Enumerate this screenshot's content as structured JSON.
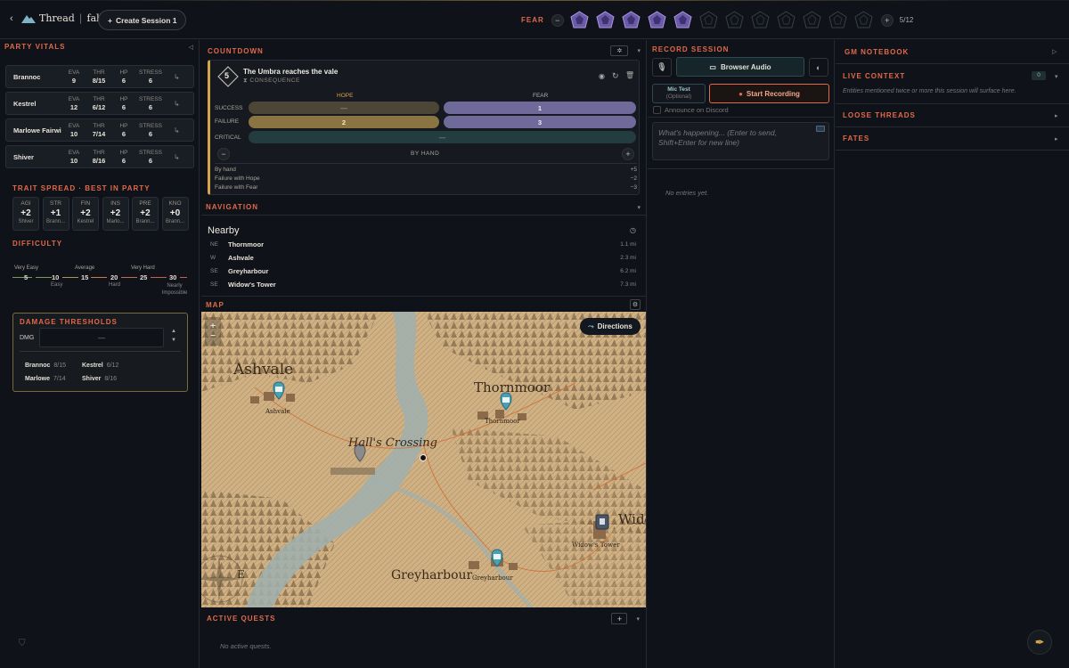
{
  "app": {
    "brand_left": "Thread",
    "brand_right": "fall",
    "create_session": "Create Session 1"
  },
  "fear": {
    "label": "FEAR",
    "filled": 5,
    "total": 12,
    "counter": "5/12"
  },
  "party": {
    "title": "PARTY VITALS",
    "members": [
      {
        "name": "Brannoc",
        "eva": "9",
        "thr": "8/15",
        "hp": "6",
        "stress": "6"
      },
      {
        "name": "Kestrel",
        "eva": "12",
        "thr": "6/12",
        "hp": "6",
        "stress": "6"
      },
      {
        "name": "Marlowe Fairwi...",
        "eva": "10",
        "thr": "7/14",
        "hp": "6",
        "stress": "6"
      },
      {
        "name": "Shiver",
        "eva": "10",
        "thr": "8/16",
        "hp": "6",
        "stress": "6"
      }
    ],
    "labels": {
      "eva": "EVA",
      "thr": "THR",
      "hp": "HP",
      "stress": "STRESS"
    }
  },
  "traits": {
    "title": "TRAIT SPREAD · BEST IN PARTY",
    "items": [
      {
        "k": "AGI",
        "v": "+2",
        "who": "Shiver"
      },
      {
        "k": "STR",
        "v": "+1",
        "who": "Brann..."
      },
      {
        "k": "FIN",
        "v": "+2",
        "who": "Kestrel"
      },
      {
        "k": "INS",
        "v": "+2",
        "who": "Marlo..."
      },
      {
        "k": "PRE",
        "v": "+2",
        "who": "Brann..."
      },
      {
        "k": "KNO",
        "v": "+0",
        "who": "Brann..."
      }
    ]
  },
  "difficulty": {
    "title": "DIFFICULTY",
    "top": [
      "Very Easy",
      "Average",
      "Very Hard"
    ],
    "nums": [
      "5",
      "10",
      "15",
      "20",
      "25",
      "30"
    ],
    "bottom": [
      "Easy",
      "Hard",
      "Nearly Impossible"
    ]
  },
  "damage": {
    "title": "DAMAGE THRESHOLDS",
    "dmg_label": "DMG",
    "dmg_value": "—",
    "rows": [
      {
        "name": "Brannoc",
        "val": "8/15"
      },
      {
        "name": "Kestrel",
        "val": "6/12"
      },
      {
        "name": "Marlowe",
        "val": "7/14"
      },
      {
        "name": "Shiver",
        "val": "8/16"
      }
    ]
  },
  "countdown": {
    "title": "COUNTDOWN",
    "value": "5",
    "name": "The Umbra reaches the vale",
    "type": "CONSEQUENCE",
    "hope": "HOPE",
    "fear": "FEAR",
    "success": "SUCCESS",
    "failure": "FAILURE",
    "critical": "CRITICAL",
    "success_hope": "—",
    "success_fear": "1",
    "failure_hope": "2",
    "failure_fear": "3",
    "critical_val": "—",
    "mode": "BY HAND",
    "rules": [
      {
        "k": "By hand",
        "v": "+5"
      },
      {
        "k": "Failure with Hope",
        "v": "−2"
      },
      {
        "k": "Failure with Fear",
        "v": "−3"
      }
    ]
  },
  "navigation": {
    "title": "NAVIGATION",
    "nearby": "Nearby",
    "places": [
      {
        "dir": "NE",
        "name": "Thornmoor",
        "dist": "1.1 mi"
      },
      {
        "dir": "W",
        "name": "Ashvale",
        "dist": "2.3 mi"
      },
      {
        "dir": "SE",
        "name": "Greyharbour",
        "dist": "6.2 mi"
      },
      {
        "dir": "SE",
        "name": "Widow's Tower",
        "dist": "7.3 mi"
      }
    ]
  },
  "map": {
    "title": "MAP",
    "directions": "Directions",
    "labels": {
      "ashvale": "Ashvale",
      "thornmoor": "Thornmoor",
      "crossing": "Hall's Crossing",
      "greyharbour": "Greyharbour",
      "widow": "Widow's Tower",
      "wido": "Wido",
      "e": "E"
    }
  },
  "quests": {
    "title": "ACTIVE QUESTS",
    "empty": "No active quests."
  },
  "record": {
    "title": "RECORD SESSION",
    "browser_audio": "Browser Audio",
    "mic_test": "Mic Test",
    "optional": "(Optional)",
    "start": "Start Recording",
    "announce": "Announce on Discord",
    "placeholder": "What's happening... (Enter to send, Shift+Enter for new line)",
    "empty": "No entries yet."
  },
  "gm": {
    "title": "GM NOTEBOOK",
    "live": "LIVE CONTEXT",
    "live_count": "0",
    "live_hint": "Entities mentioned twice or more this session will surface here.",
    "loose": "LOOSE THREADS",
    "fates": "FATES"
  },
  "colors": {
    "accent": "#e06a4a",
    "hope": "#d8a44a",
    "fear": "#8d87c4"
  }
}
